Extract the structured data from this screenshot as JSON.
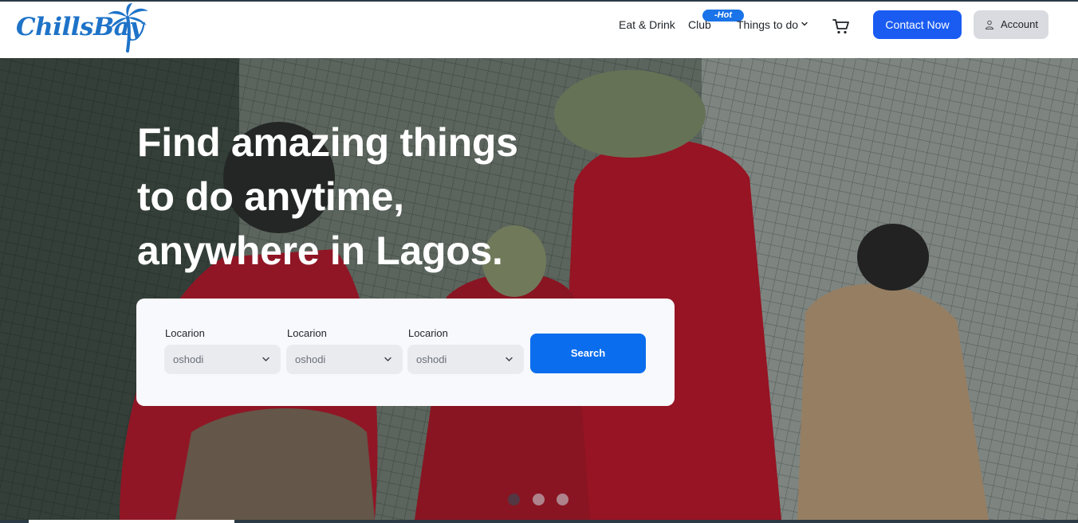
{
  "header": {
    "logo_text": "ChillsBay",
    "nav": {
      "eat_drink": "Eat & Drink",
      "club": "Club",
      "hot_badge": "-Hot",
      "things_to_do": "Things to do"
    },
    "icons": {
      "dropdown": "chevron-down-icon",
      "cart": "cart-icon",
      "account": "user-icon"
    },
    "contact_label": "Contact Now",
    "account_label": "Account"
  },
  "hero": {
    "headline_lines": [
      "Find amazing things",
      "to do anytime,",
      "anywhere in Lagos."
    ],
    "search": {
      "fields": [
        {
          "label": "Locarion",
          "value": "oshodi"
        },
        {
          "label": "Locarion",
          "value": "oshodi"
        },
        {
          "label": "Locarion",
          "value": "oshodi"
        }
      ],
      "button_label": "Search"
    },
    "carousel": {
      "slide_count": 3
    }
  },
  "colors": {
    "primary_blue": "#1a5cf2",
    "search_blue": "#0a6ded",
    "hot_badge": "#1a73e8",
    "logo_blue": "#1e73c8"
  }
}
